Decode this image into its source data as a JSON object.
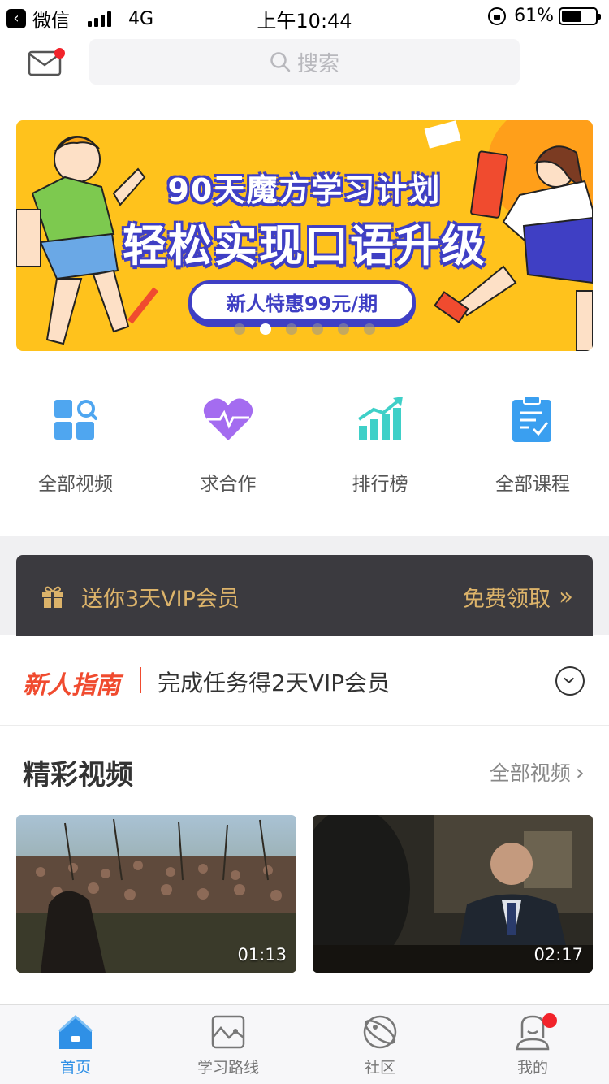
{
  "status_bar": {
    "back_app": "微信",
    "network": "4G",
    "time": "上午10:44",
    "battery_percent": "61%",
    "battery_level": 0.61
  },
  "header": {
    "search_placeholder": "搜索",
    "mail_has_unread": true
  },
  "banner": {
    "headline": "90天魔方学习计划",
    "subheadline": "轻松实现口语升级",
    "promo_button": "新人特惠99元/期",
    "slide_count": 6,
    "active_slide": 2,
    "bg_color": "#ffc21c",
    "accent_color": "#3f3fc4"
  },
  "quick_menu": [
    {
      "label": "全部视频",
      "icon": "video-grid-icon"
    },
    {
      "label": "求合作",
      "icon": "heart-pulse-icon"
    },
    {
      "label": "排行榜",
      "icon": "ranking-chart-icon"
    },
    {
      "label": "全部课程",
      "icon": "course-list-icon"
    }
  ],
  "vip_banner": {
    "text": "送你3天VIP会员",
    "action": "免费领取",
    "color": "#dcb36a"
  },
  "newbie_guide": {
    "title": "新人指南",
    "text": "完成任务得2天VIP会员"
  },
  "featured_videos": {
    "title": "精彩视频",
    "more_label": "全部视频",
    "items": [
      {
        "duration": "01:13"
      },
      {
        "duration": "02:17"
      }
    ]
  },
  "tab_bar": {
    "active_color": "#2f90e6",
    "items": [
      {
        "label": "首页",
        "icon": "home-icon",
        "active": true
      },
      {
        "label": "学习路线",
        "icon": "learning-path-icon",
        "active": false
      },
      {
        "label": "社区",
        "icon": "community-icon",
        "active": false
      },
      {
        "label": "我的",
        "icon": "profile-icon",
        "active": false,
        "badge": true
      }
    ]
  }
}
